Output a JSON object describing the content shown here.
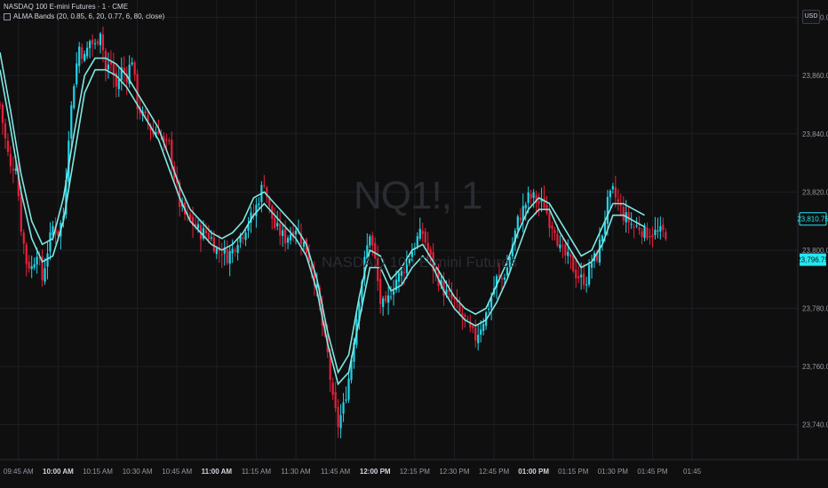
{
  "header": {
    "symbol_line": "NASDAQ 100 E-mini Futures · 1 · CME",
    "indicator_line": "ALMA Bands (20, 0.85, 6, 20, 0.77, 6, 80, close)"
  },
  "watermark": {
    "ticker": "NQ1!, 1",
    "name": "NASDAQ 100 E-mini Futures"
  },
  "currency_button": "USD",
  "colors": {
    "up": "#22d3e6",
    "down": "#e8203a",
    "band": "#7fe8e2",
    "grid": "#1e1f24",
    "axis_text": "#9598a1",
    "background": "#0f0f10"
  },
  "chart_data": {
    "type": "candlestick",
    "title": "",
    "xlabel": "",
    "ylabel": "",
    "ylim": [
      23728,
      23886
    ],
    "y_ticks": [
      23740,
      23760,
      23780,
      23800,
      23820,
      23840,
      23860,
      23880
    ],
    "y_tick_labels": [
      "23,740.00",
      "23,760.00",
      "23,780.00",
      "23,800.00",
      "23,820.00",
      "23,840.00",
      "23,860.00",
      "23,880.00"
    ],
    "x_range_minutes": [
      578,
      880
    ],
    "x_ticks": [
      {
        "minute": 585,
        "label": "09:45 AM",
        "bold": false
      },
      {
        "minute": 600,
        "label": "10:00 AM",
        "bold": true
      },
      {
        "minute": 615,
        "label": "10:15 AM",
        "bold": false
      },
      {
        "minute": 630,
        "label": "10:30 AM",
        "bold": false
      },
      {
        "minute": 645,
        "label": "10:45 AM",
        "bold": false
      },
      {
        "minute": 660,
        "label": "11:00 AM",
        "bold": true
      },
      {
        "minute": 675,
        "label": "11:15 AM",
        "bold": false
      },
      {
        "minute": 690,
        "label": "11:30 AM",
        "bold": false
      },
      {
        "minute": 705,
        "label": "11:45 AM",
        "bold": false
      },
      {
        "minute": 720,
        "label": "12:00 PM",
        "bold": true
      },
      {
        "minute": 735,
        "label": "12:15 PM",
        "bold": false
      },
      {
        "minute": 750,
        "label": "12:30 PM",
        "bold": false
      },
      {
        "minute": 765,
        "label": "12:45 PM",
        "bold": false
      },
      {
        "minute": 780,
        "label": "01:00 PM",
        "bold": true
      },
      {
        "minute": 795,
        "label": "01:15 PM",
        "bold": false
      },
      {
        "minute": 810,
        "label": "01:30 PM",
        "bold": false
      },
      {
        "minute": 825,
        "label": "01:45 PM",
        "bold": false
      },
      {
        "minute": 840,
        "label": "01:45",
        "bold": false
      }
    ],
    "close_path": [
      [
        578,
        23850
      ],
      [
        580,
        23838
      ],
      [
        582,
        23828
      ],
      [
        584,
        23830
      ],
      [
        586,
        23808
      ],
      [
        588,
        23796
      ],
      [
        590,
        23794
      ],
      [
        592,
        23800
      ],
      [
        594,
        23790
      ],
      [
        596,
        23800
      ],
      [
        598,
        23808
      ],
      [
        600,
        23806
      ],
      [
        602,
        23812
      ],
      [
        604,
        23840
      ],
      [
        606,
        23858
      ],
      [
        608,
        23870
      ],
      [
        610,
        23866
      ],
      [
        612,
        23872
      ],
      [
        614,
        23870
      ],
      [
        616,
        23876
      ],
      [
        618,
        23862
      ],
      [
        620,
        23864
      ],
      [
        622,
        23856
      ],
      [
        624,
        23862
      ],
      [
        626,
        23860
      ],
      [
        628,
        23866
      ],
      [
        630,
        23850
      ],
      [
        632,
        23846
      ],
      [
        634,
        23844
      ],
      [
        636,
        23840
      ],
      [
        638,
        23842
      ],
      [
        640,
        23836
      ],
      [
        642,
        23836
      ],
      [
        644,
        23826
      ],
      [
        646,
        23816
      ],
      [
        648,
        23812
      ],
      [
        650,
        23810
      ],
      [
        652,
        23808
      ],
      [
        654,
        23806
      ],
      [
        656,
        23806
      ],
      [
        658,
        23804
      ],
      [
        660,
        23800
      ],
      [
        662,
        23800
      ],
      [
        664,
        23798
      ],
      [
        666,
        23800
      ],
      [
        668,
        23804
      ],
      [
        670,
        23806
      ],
      [
        672,
        23810
      ],
      [
        674,
        23812
      ],
      [
        676,
        23818
      ],
      [
        678,
        23824
      ],
      [
        680,
        23814
      ],
      [
        682,
        23808
      ],
      [
        684,
        23806
      ],
      [
        686,
        23804
      ],
      [
        688,
        23806
      ],
      [
        690,
        23808
      ],
      [
        692,
        23804
      ],
      [
        694,
        23800
      ],
      [
        696,
        23794
      ],
      [
        698,
        23786
      ],
      [
        700,
        23774
      ],
      [
        702,
        23764
      ],
      [
        704,
        23748
      ],
      [
        706,
        23740
      ],
      [
        708,
        23746
      ],
      [
        710,
        23756
      ],
      [
        712,
        23770
      ],
      [
        714,
        23784
      ],
      [
        716,
        23796
      ],
      [
        718,
        23806
      ],
      [
        720,
        23796
      ],
      [
        722,
        23782
      ],
      [
        724,
        23780
      ],
      [
        726,
        23786
      ],
      [
        728,
        23790
      ],
      [
        730,
        23792
      ],
      [
        732,
        23796
      ],
      [
        734,
        23800
      ],
      [
        736,
        23804
      ],
      [
        738,
        23806
      ],
      [
        740,
        23800
      ],
      [
        742,
        23794
      ],
      [
        744,
        23790
      ],
      [
        746,
        23786
      ],
      [
        748,
        23784
      ],
      [
        750,
        23782
      ],
      [
        752,
        23778
      ],
      [
        754,
        23776
      ],
      [
        756,
        23772
      ],
      [
        758,
        23770
      ],
      [
        760,
        23774
      ],
      [
        762,
        23778
      ],
      [
        764,
        23784
      ],
      [
        766,
        23790
      ],
      [
        768,
        23790
      ],
      [
        770,
        23794
      ],
      [
        772,
        23802
      ],
      [
        774,
        23810
      ],
      [
        776,
        23814
      ],
      [
        778,
        23818
      ],
      [
        780,
        23818
      ],
      [
        782,
        23816
      ],
      [
        784,
        23816
      ],
      [
        786,
        23810
      ],
      [
        788,
        23808
      ],
      [
        790,
        23800
      ],
      [
        792,
        23798
      ],
      [
        794,
        23796
      ],
      [
        796,
        23792
      ],
      [
        798,
        23790
      ],
      [
        800,
        23790
      ],
      [
        802,
        23796
      ],
      [
        804,
        23798
      ],
      [
        806,
        23806
      ],
      [
        808,
        23816
      ],
      [
        810,
        23820
      ],
      [
        812,
        23816
      ],
      [
        814,
        23812
      ],
      [
        816,
        23810
      ],
      [
        818,
        23808
      ],
      [
        820,
        23808
      ],
      [
        822,
        23806
      ]
    ],
    "band_upper": [
      [
        578,
        23868
      ],
      [
        582,
        23848
      ],
      [
        586,
        23826
      ],
      [
        590,
        23810
      ],
      [
        594,
        23802
      ],
      [
        598,
        23804
      ],
      [
        602,
        23818
      ],
      [
        606,
        23840
      ],
      [
        610,
        23860
      ],
      [
        614,
        23866
      ],
      [
        618,
        23866
      ],
      [
        622,
        23864
      ],
      [
        626,
        23860
      ],
      [
        630,
        23854
      ],
      [
        634,
        23848
      ],
      [
        638,
        23842
      ],
      [
        642,
        23832
      ],
      [
        646,
        23822
      ],
      [
        650,
        23814
      ],
      [
        654,
        23810
      ],
      [
        658,
        23806
      ],
      [
        662,
        23804
      ],
      [
        666,
        23806
      ],
      [
        670,
        23810
      ],
      [
        674,
        23818
      ],
      [
        678,
        23820
      ],
      [
        682,
        23816
      ],
      [
        686,
        23812
      ],
      [
        690,
        23808
      ],
      [
        694,
        23802
      ],
      [
        698,
        23790
      ],
      [
        702,
        23772
      ],
      [
        706,
        23758
      ],
      [
        710,
        23764
      ],
      [
        714,
        23784
      ],
      [
        718,
        23800
      ],
      [
        722,
        23798
      ],
      [
        726,
        23790
      ],
      [
        730,
        23794
      ],
      [
        734,
        23800
      ],
      [
        738,
        23802
      ],
      [
        742,
        23796
      ],
      [
        746,
        23790
      ],
      [
        750,
        23784
      ],
      [
        754,
        23780
      ],
      [
        758,
        23778
      ],
      [
        762,
        23780
      ],
      [
        766,
        23788
      ],
      [
        770,
        23796
      ],
      [
        774,
        23806
      ],
      [
        778,
        23814
      ],
      [
        782,
        23818
      ],
      [
        786,
        23816
      ],
      [
        790,
        23810
      ],
      [
        794,
        23804
      ],
      [
        798,
        23798
      ],
      [
        802,
        23800
      ],
      [
        806,
        23808
      ],
      [
        810,
        23816
      ],
      [
        814,
        23816
      ],
      [
        818,
        23814
      ],
      [
        822,
        23812
      ]
    ],
    "band_lower": [
      [
        578,
        23862
      ],
      [
        582,
        23842
      ],
      [
        586,
        23820
      ],
      [
        590,
        23804
      ],
      [
        594,
        23796
      ],
      [
        598,
        23798
      ],
      [
        602,
        23810
      ],
      [
        606,
        23832
      ],
      [
        610,
        23854
      ],
      [
        614,
        23862
      ],
      [
        618,
        23862
      ],
      [
        622,
        23860
      ],
      [
        626,
        23856
      ],
      [
        630,
        23850
      ],
      [
        634,
        23844
      ],
      [
        638,
        23838
      ],
      [
        642,
        23828
      ],
      [
        646,
        23818
      ],
      [
        650,
        23810
      ],
      [
        654,
        23806
      ],
      [
        658,
        23802
      ],
      [
        662,
        23800
      ],
      [
        666,
        23802
      ],
      [
        670,
        23806
      ],
      [
        674,
        23812
      ],
      [
        678,
        23816
      ],
      [
        682,
        23812
      ],
      [
        686,
        23808
      ],
      [
        690,
        23804
      ],
      [
        694,
        23798
      ],
      [
        698,
        23786
      ],
      [
        702,
        23768
      ],
      [
        706,
        23754
      ],
      [
        710,
        23758
      ],
      [
        714,
        23776
      ],
      [
        718,
        23794
      ],
      [
        722,
        23794
      ],
      [
        726,
        23786
      ],
      [
        730,
        23788
      ],
      [
        734,
        23794
      ],
      [
        738,
        23798
      ],
      [
        742,
        23794
      ],
      [
        746,
        23786
      ],
      [
        750,
        23780
      ],
      [
        754,
        23776
      ],
      [
        758,
        23774
      ],
      [
        762,
        23776
      ],
      [
        766,
        23782
      ],
      [
        770,
        23790
      ],
      [
        774,
        23800
      ],
      [
        778,
        23810
      ],
      [
        782,
        23814
      ],
      [
        786,
        23814
      ],
      [
        790,
        23806
      ],
      [
        794,
        23800
      ],
      [
        798,
        23794
      ],
      [
        802,
        23796
      ],
      [
        806,
        23802
      ],
      [
        810,
        23812
      ],
      [
        814,
        23812
      ],
      [
        818,
        23810
      ],
      [
        822,
        23808
      ]
    ],
    "price_tags": [
      {
        "value": 23810.75,
        "label": "23,810.75",
        "style": "outline"
      },
      {
        "value": 23796.75,
        "label": "23,796.75",
        "style": "filled"
      }
    ]
  }
}
